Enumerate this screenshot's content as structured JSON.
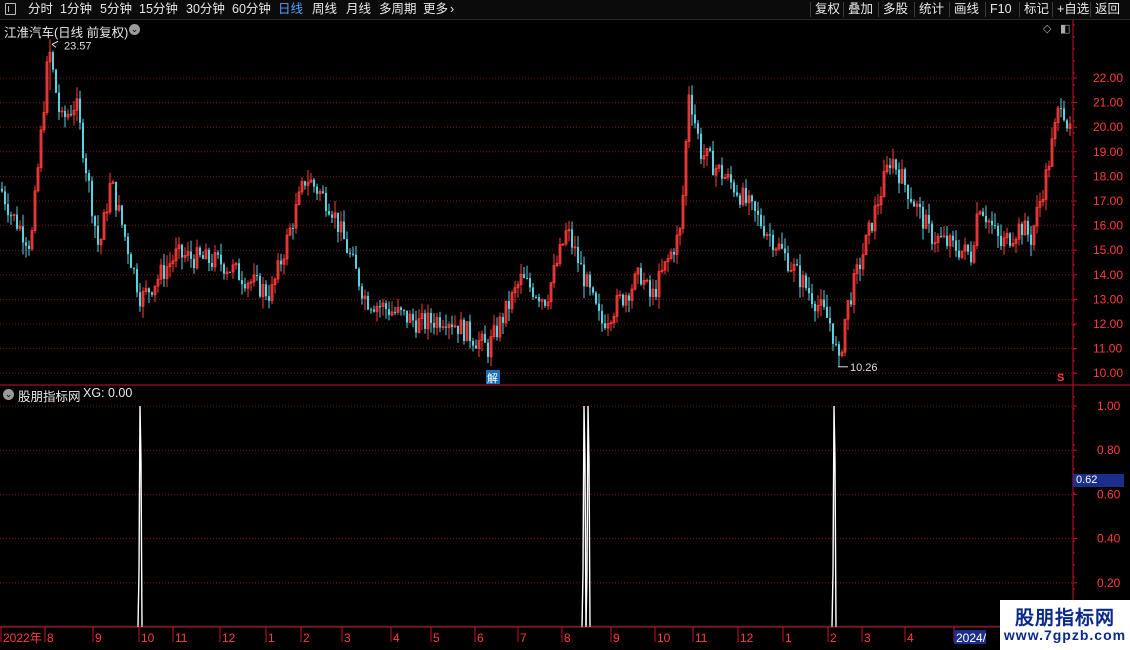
{
  "toolbar": {
    "left_items": [
      {
        "label": "分时",
        "active": false
      },
      {
        "label": "1分钟",
        "active": false
      },
      {
        "label": "5分钟",
        "active": false
      },
      {
        "label": "15分钟",
        "active": false
      },
      {
        "label": "30分钟",
        "active": false
      },
      {
        "label": "60分钟",
        "active": false
      },
      {
        "label": "日线",
        "active": true
      },
      {
        "label": "周线",
        "active": false
      },
      {
        "label": "月线",
        "active": false
      },
      {
        "label": "多周期",
        "active": false
      },
      {
        "label": "更多",
        "active": false
      }
    ],
    "right_items": [
      "复权",
      "叠加",
      "多股",
      "统计",
      "画线",
      "F10",
      "标记",
      "+自选",
      "返回"
    ]
  },
  "price_panel": {
    "title": "江淮汽车(日线 前复权)",
    "high_label": "23.57",
    "low_label": "10.26",
    "unlock_label": "解",
    "s_marker": "S",
    "y_ticks": [
      "22.00",
      "21.00",
      "20.00",
      "19.00",
      "18.00",
      "17.00",
      "16.00",
      "15.00",
      "14.00",
      "13.00",
      "12.00",
      "11.00",
      "10.00"
    ]
  },
  "indicator_panel": {
    "title": "股朋指标网",
    "value_label": "XG: 0.00",
    "y_ticks": [
      "1.00",
      "0.80",
      "0.60",
      "0.40",
      "0.20"
    ],
    "marker_value": "0.62"
  },
  "date_axis": {
    "labels": [
      "2022年",
      "8",
      "9",
      "10",
      "11",
      "12",
      "1",
      "2",
      "3",
      "4",
      "5",
      "6",
      "7",
      "8",
      "9",
      "10",
      "11",
      "12",
      "1",
      "2",
      "3",
      "4",
      "2024/"
    ]
  },
  "watermark": {
    "line1": "股朋指标网",
    "line2": "www.7gpzb.com"
  },
  "colors": {
    "up": "#ff3b3b",
    "down": "#54d4e0",
    "grid": "#7a1414",
    "axis": "#c8102e",
    "signal": "#ffffff",
    "active": "#4fa3ff"
  },
  "chart_data": [
    {
      "type": "line",
      "title": "江淮汽车(日线 前复权)",
      "description_of_series": "daily close (approximate, read from candlestick chart)",
      "x": [
        "2022-07",
        "2022-08",
        "2022-09",
        "2022-10",
        "2022-11",
        "2022-12",
        "2023-01",
        "2023-02",
        "2023-03",
        "2023-04",
        "2023-05",
        "2023-06",
        "2023-07",
        "2023-08",
        "2023-09",
        "2023-10",
        "2023-11",
        "2023-12",
        "2024-01",
        "2024-02",
        "2024-03",
        "2024-04",
        "2024-05"
      ],
      "series": [
        {
          "values": [
            17.5,
            21.0,
            16.0,
            14.2,
            14.0,
            14.0,
            16.0,
            17.2,
            14.0,
            12.5,
            11.5,
            11.3,
            13.6,
            15.0,
            12.6,
            14.8,
            18.5,
            17.0,
            14.0,
            11.2,
            17.8,
            15.5,
            20.0
          ]
        }
      ],
      "ylim": [
        10.0,
        23.57
      ],
      "annotations": [
        {
          "label": "23.57",
          "kind": "high"
        },
        {
          "label": "10.26",
          "kind": "low"
        }
      ]
    },
    {
      "type": "line",
      "title": "股朋指标网",
      "series": [
        {
          "name": "XG",
          "values": [
            0,
            0,
            1,
            0,
            0,
            0,
            0,
            0,
            0,
            0,
            0,
            0,
            0,
            1,
            1,
            0,
            0,
            0,
            0,
            1,
            0,
            0,
            0
          ]
        }
      ],
      "ylim": [
        0,
        1.0
      ]
    }
  ]
}
